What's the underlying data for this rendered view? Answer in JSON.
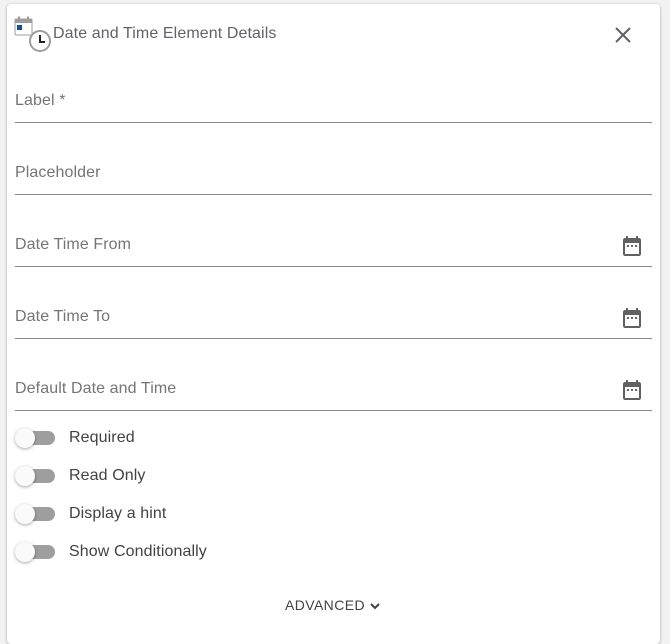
{
  "dialog": {
    "title": "Date and Time Element Details",
    "icon": "date-time-icon",
    "close_icon": "close-icon"
  },
  "fields": {
    "label": {
      "placeholder": "Label *"
    },
    "placeholder": {
      "placeholder": "Placeholder"
    },
    "date_time_from": {
      "placeholder": "Date Time From",
      "icon": "calendar-icon"
    },
    "date_time_to": {
      "placeholder": "Date Time To",
      "icon": "calendar-icon"
    },
    "default_date_time": {
      "placeholder": "Default Date and Time",
      "icon": "calendar-icon"
    }
  },
  "toggles": {
    "required": {
      "label": "Required",
      "checked": false
    },
    "read_only": {
      "label": "Read Only",
      "checked": false
    },
    "display_hint": {
      "label": "Display a hint",
      "checked": false
    },
    "show_conditionally": {
      "label": "Show Conditionally",
      "checked": false
    }
  },
  "advanced": {
    "label": "ADVANCED",
    "icon": "chevron-down-icon"
  },
  "colors": {
    "text_muted": "#757575",
    "text_dark": "#424242",
    "underline": "#8a8a8a",
    "toggle_track": "#9e9e9e",
    "icon_blue": "#1a4f8c"
  }
}
